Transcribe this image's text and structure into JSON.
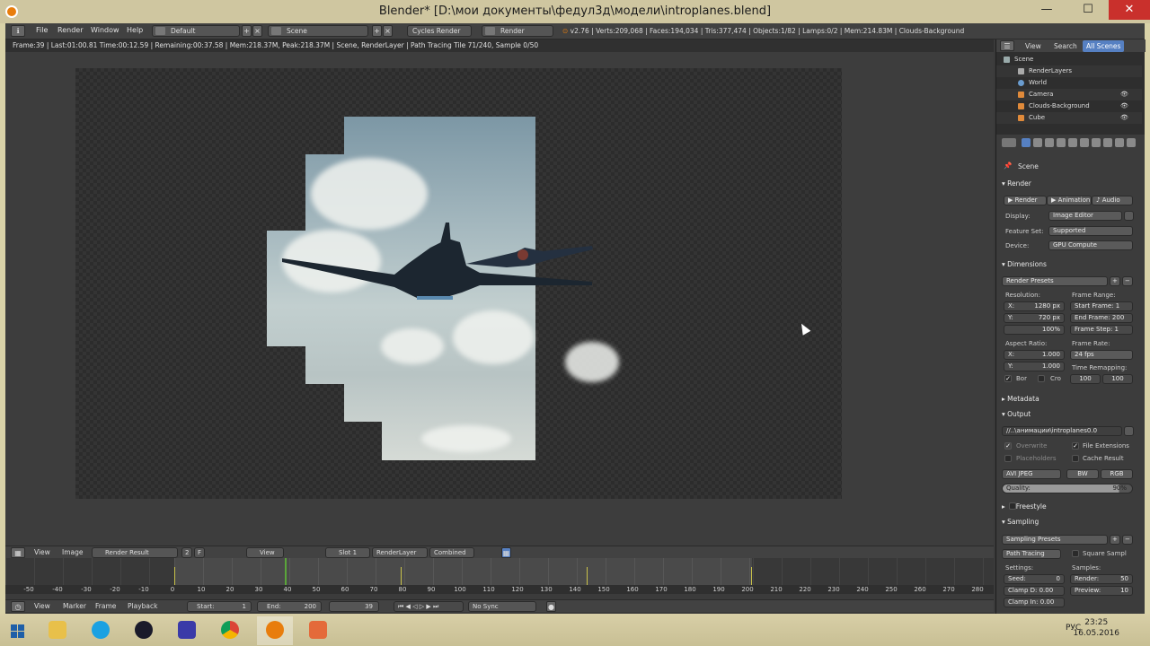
{
  "window": {
    "title": "Blender* [D:\\мои документы\\федул3д\\модели\\introplanes.blend]",
    "minimize": "—",
    "maximize": "☐",
    "close": "✕"
  },
  "menubar": {
    "items": [
      "File",
      "Render",
      "Window",
      "Help"
    ],
    "layout": "Default",
    "scene": "Scene",
    "engine": "Cycles Render",
    "render_slot": "Render",
    "stats": "v2.76 | Verts:209,068 | Faces:194,034 | Tris:377,474 | Objects:1/82 | Lamps:0/2 | Mem:214.83M | Clouds-Background"
  },
  "render_status": "Frame:39 | Last:01:00.81 Time:00:12.59 | Remaining:00:37.58 | Mem:218.37M, Peak:218.37M | Scene, RenderLayer | Path Tracing Tile 71/240, Sample 0/50",
  "image_header": {
    "view": "View",
    "image": "Image",
    "image_name": "Render Result",
    "users": "2",
    "fake": "F",
    "view2": "View",
    "slot": "Slot 1",
    "layer": "RenderLayer",
    "pass": "Combined"
  },
  "timeline": {
    "ticks": [
      "-50",
      "-40",
      "-30",
      "-20",
      "-10",
      "0",
      "10",
      "20",
      "30",
      "40",
      "50",
      "60",
      "70",
      "80",
      "90",
      "100",
      "110",
      "120",
      "130",
      "140",
      "150",
      "160",
      "170",
      "180",
      "190",
      "200",
      "210",
      "220",
      "230",
      "240",
      "250",
      "260",
      "270",
      "280"
    ],
    "header": {
      "view": "View",
      "marker": "Marker",
      "frame": "Frame",
      "playback": "Playback",
      "start_label": "Start:",
      "start": "1",
      "end_label": "End:",
      "end": "200",
      "current": "39",
      "sync": "No Sync"
    }
  },
  "outliner": {
    "view": "View",
    "search": "Search",
    "filter": "All Scenes",
    "rows": [
      "Scene",
      "RenderLayers",
      "World",
      "Camera",
      "Clouds-Background",
      "Cube"
    ]
  },
  "properties": {
    "context": "Scene",
    "render": {
      "title": "Render",
      "buttons": [
        "Render",
        "Animation",
        "Audio"
      ],
      "display_label": "Display:",
      "display": "Image Editor",
      "feature_label": "Feature Set:",
      "feature": "Supported",
      "device_label": "Device:",
      "device": "GPU Compute"
    },
    "dimensions": {
      "title": "Dimensions",
      "presets": "Render Presets",
      "resolution_label": "Resolution:",
      "res_x": "1280 px",
      "res_y": "720 px",
      "res_pct": "100%",
      "frame_range_label": "Frame Range:",
      "start_frame": "Start Frame: 1",
      "end_frame": "End Frame: 200",
      "frame_step": "Frame Step: 1",
      "aspect_label": "Aspect Ratio:",
      "aspect_x": "1.000",
      "aspect_y": "1.000",
      "frame_rate_label": "Frame Rate:",
      "frame_rate": "24 fps",
      "time_remap_label": "Time Remapping:",
      "remap_old": "100",
      "remap_new": "100",
      "bor": "Bor",
      "cro": "Cro"
    },
    "metadata": "Metadata",
    "output": {
      "title": "Output",
      "path": "//..\\анимации\\introplanes0.0",
      "overwrite": "Overwrite",
      "file_ext": "File Extensions",
      "placeholders": "Placeholders",
      "cache": "Cache Result",
      "format": "AVI JPEG",
      "bw": "BW",
      "rgb": "RGB",
      "quality_label": "Quality:",
      "quality": "90%",
      "quality_value": 0.9
    },
    "freestyle": "Freestyle",
    "sampling": {
      "title": "Sampling",
      "presets": "Sampling Presets",
      "method": "Path Tracing",
      "square": "Square Sampl",
      "settings_label": "Settings:",
      "samples_label": "Samples:",
      "seed": "Seed:",
      "seed_val": "0",
      "clamp_d": "Clamp D: 0.00",
      "clamp_i": "Clamp In: 0.00",
      "render": "Render:",
      "render_val": "50",
      "preview": "Preview:",
      "preview_val": "10"
    }
  },
  "taskbar": {
    "lang": "РУС",
    "time": "23:25",
    "date": "16.05.2016"
  }
}
